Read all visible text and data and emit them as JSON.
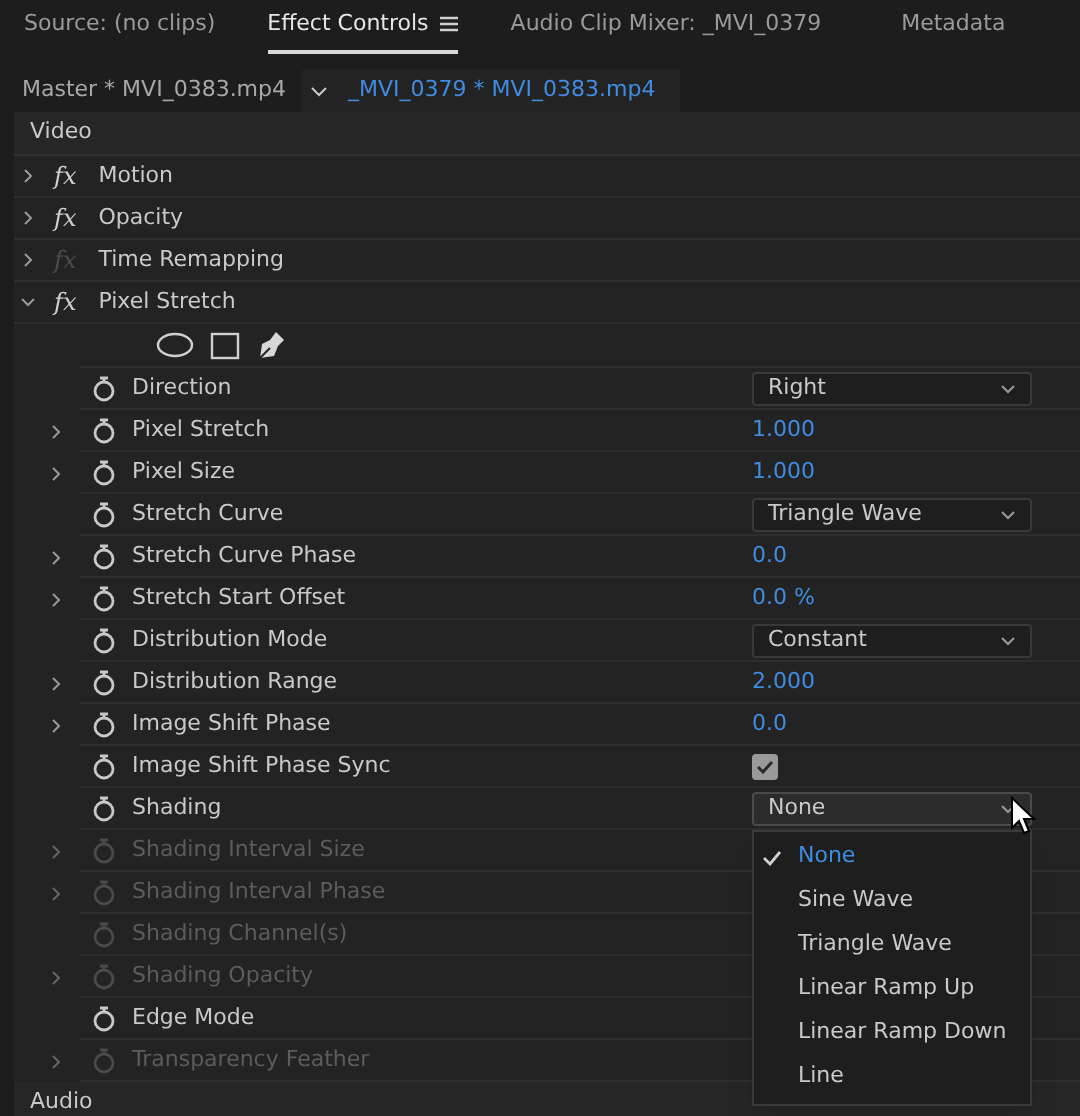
{
  "panel_tabs": [
    {
      "label": "Source: (no clips)",
      "selected": false,
      "menu": false
    },
    {
      "label": "Effect Controls",
      "selected": true,
      "menu": true
    },
    {
      "label": "Audio Clip Mixer: _MVI_0379",
      "selected": false,
      "menu": false
    },
    {
      "label": "Metadata",
      "selected": false,
      "menu": false
    }
  ],
  "clip_tabs": [
    {
      "label": "Master * MVI_0383.mp4",
      "selected": false
    },
    {
      "label": "_MVI_0379 * MVI_0383.mp4",
      "selected": true
    }
  ],
  "video_header": "Video",
  "effects": [
    {
      "badge": "fx",
      "name": "Motion",
      "expanded": false,
      "enabled": true
    },
    {
      "badge": "fx",
      "name": "Opacity",
      "expanded": false,
      "enabled": true
    },
    {
      "badge": "fx",
      "name": "Time Remapping",
      "expanded": false,
      "enabled": false
    },
    {
      "badge": "fx",
      "name": "Pixel Stretch",
      "expanded": true,
      "enabled": true
    }
  ],
  "params": [
    {
      "name": "Direction",
      "expandable": false,
      "disabled": false,
      "kind": "dropdown",
      "value": "Right",
      "open": false
    },
    {
      "name": "Pixel Stretch",
      "expandable": true,
      "disabled": false,
      "kind": "number",
      "value": "1.000"
    },
    {
      "name": "Pixel Size",
      "expandable": true,
      "disabled": false,
      "kind": "number",
      "value": "1.000"
    },
    {
      "name": "Stretch Curve",
      "expandable": false,
      "disabled": false,
      "kind": "dropdown",
      "value": "Triangle Wave",
      "open": false
    },
    {
      "name": "Stretch Curve Phase",
      "expandable": true,
      "disabled": false,
      "kind": "number",
      "value": "0.0"
    },
    {
      "name": "Stretch Start Offset",
      "expandable": true,
      "disabled": false,
      "kind": "number",
      "value": "0.0 %"
    },
    {
      "name": "Distribution Mode",
      "expandable": false,
      "disabled": false,
      "kind": "dropdown",
      "value": "Constant",
      "open": false
    },
    {
      "name": "Distribution Range",
      "expandable": true,
      "disabled": false,
      "kind": "number",
      "value": "2.000"
    },
    {
      "name": "Image Shift Phase",
      "expandable": true,
      "disabled": false,
      "kind": "number",
      "value": "0.0"
    },
    {
      "name": "Image Shift Phase Sync",
      "expandable": false,
      "disabled": false,
      "kind": "checkbox",
      "checked": true
    },
    {
      "name": "Shading",
      "expandable": false,
      "disabled": false,
      "kind": "dropdown",
      "value": "None",
      "open": true
    },
    {
      "name": "Shading Interval Size",
      "expandable": true,
      "disabled": true,
      "kind": "none"
    },
    {
      "name": "Shading Interval Phase",
      "expandable": true,
      "disabled": true,
      "kind": "none"
    },
    {
      "name": "Shading Channel(s)",
      "expandable": false,
      "disabled": true,
      "kind": "none"
    },
    {
      "name": "Shading Opacity",
      "expandable": true,
      "disabled": true,
      "kind": "none"
    },
    {
      "name": "Edge Mode",
      "expandable": false,
      "disabled": false,
      "kind": "none"
    },
    {
      "name": "Transparency Feather",
      "expandable": true,
      "disabled": true,
      "kind": "none"
    }
  ],
  "dropdown_menu": [
    {
      "label": "None",
      "selected": true
    },
    {
      "label": "Sine Wave",
      "selected": false
    },
    {
      "label": "Triangle Wave",
      "selected": false
    },
    {
      "label": "Linear Ramp Up",
      "selected": false
    },
    {
      "label": "Linear Ramp Down",
      "selected": false
    },
    {
      "label": "Line",
      "selected": false
    }
  ],
  "audio_header": "Audio"
}
